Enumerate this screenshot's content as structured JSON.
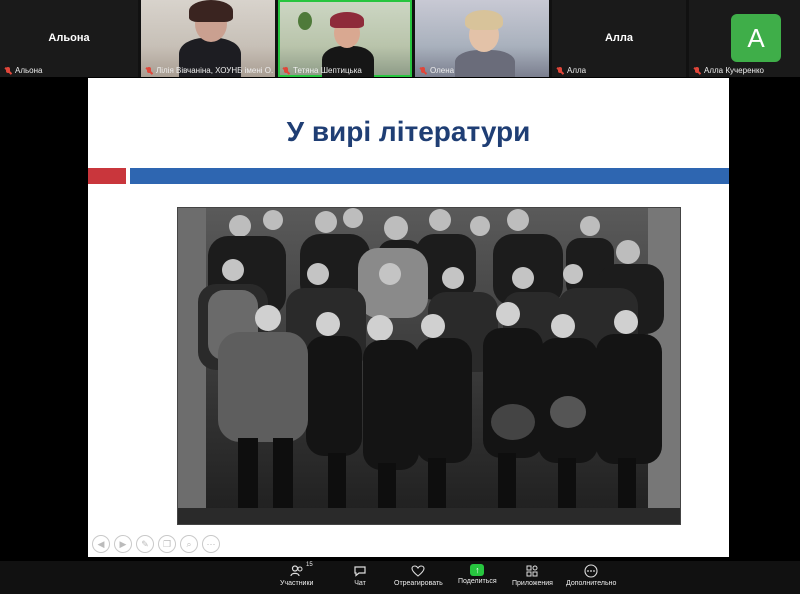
{
  "participants": [
    {
      "name": "Альона",
      "display": "Альона",
      "type": "name-only"
    },
    {
      "name": "Лілія Вівчаніна, ХОУНБ імені О...",
      "type": "video"
    },
    {
      "name": "Тетяна Шептицька",
      "type": "video",
      "active": true
    },
    {
      "name": "Олена",
      "type": "video"
    },
    {
      "name": "Алла",
      "display": "Алла",
      "type": "name-only"
    },
    {
      "name": "Алла Кучеренко",
      "type": "avatar",
      "initial": "A"
    }
  ],
  "slide": {
    "title": "У вирі літератури",
    "accent_red": "#c9363c",
    "accent_blue": "#2e66b1",
    "title_color": "#1f3e74"
  },
  "slide_tools": [
    "back-icon",
    "next-icon",
    "pen-icon",
    "copy-icon",
    "zoom-icon",
    "more-icon"
  ],
  "toolbar": {
    "participants_label": "Участники",
    "participants_count": "15",
    "chat_label": "Чат",
    "react_label": "Отреагировать",
    "share_label": "Поделиться",
    "apps_label": "Приложения",
    "more_label": "Дополнительно"
  }
}
